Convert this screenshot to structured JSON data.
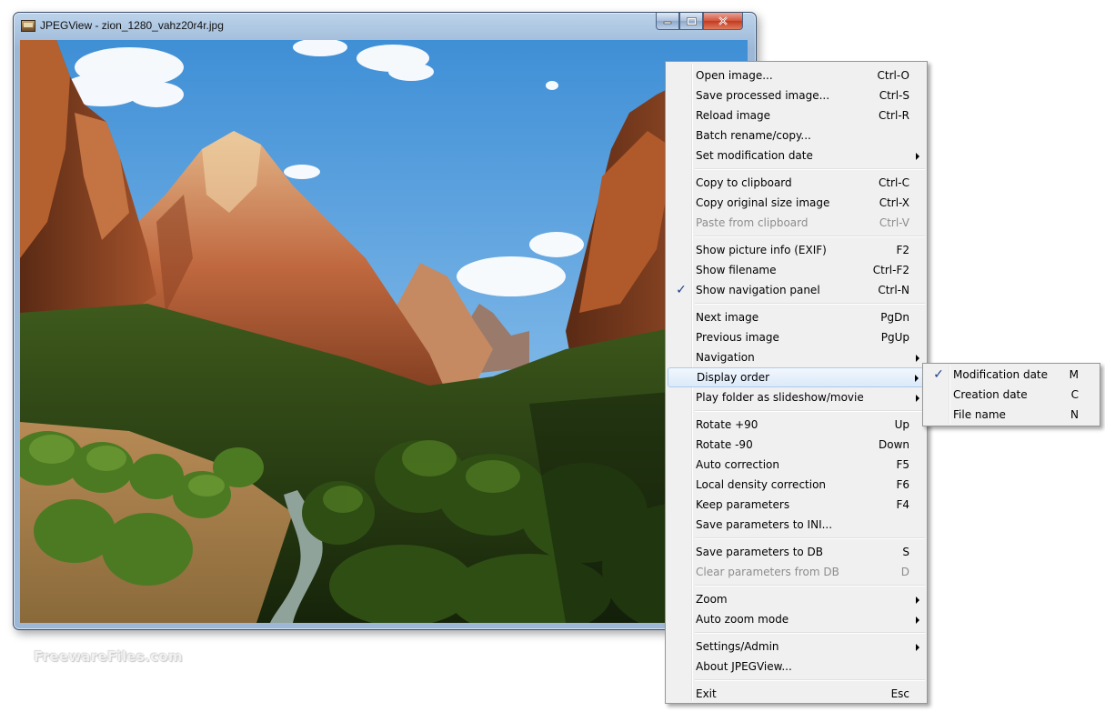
{
  "window": {
    "title": "JPEGView - zion_1280_vahz20r4r.jpg",
    "caption_buttons": {
      "minimize": "▭",
      "maximize": "▢",
      "close": "x"
    }
  },
  "watermark": "FreewareFiles.com",
  "context_menu": {
    "groups": [
      [
        {
          "label": "Open image...",
          "shortcut": "Ctrl-O"
        },
        {
          "label": "Save processed image...",
          "shortcut": "Ctrl-S"
        },
        {
          "label": "Reload image",
          "shortcut": "Ctrl-R"
        },
        {
          "label": "Batch rename/copy...",
          "shortcut": ""
        },
        {
          "label": "Set modification date",
          "shortcut": "",
          "submenu": true
        }
      ],
      [
        {
          "label": "Copy to clipboard",
          "shortcut": "Ctrl-C"
        },
        {
          "label": "Copy original size image",
          "shortcut": "Ctrl-X"
        },
        {
          "label": "Paste from clipboard",
          "shortcut": "Ctrl-V",
          "disabled": true
        }
      ],
      [
        {
          "label": "Show picture info (EXIF)",
          "shortcut": "F2"
        },
        {
          "label": "Show filename",
          "shortcut": "Ctrl-F2"
        },
        {
          "label": "Show navigation panel",
          "shortcut": "Ctrl-N",
          "checked": true
        }
      ],
      [
        {
          "label": "Next image",
          "shortcut": "PgDn"
        },
        {
          "label": "Previous image",
          "shortcut": "PgUp"
        },
        {
          "label": "Navigation",
          "shortcut": "",
          "submenu": true
        },
        {
          "label": "Display order",
          "shortcut": "",
          "submenu": true,
          "highlighted": true
        },
        {
          "label": "Play folder as slideshow/movie",
          "shortcut": "",
          "submenu": true
        }
      ],
      [
        {
          "label": "Rotate +90",
          "shortcut": "Up"
        },
        {
          "label": "Rotate -90",
          "shortcut": "Down"
        },
        {
          "label": "Auto correction",
          "shortcut": "F5"
        },
        {
          "label": "Local density correction",
          "shortcut": "F6"
        },
        {
          "label": "Keep parameters",
          "shortcut": "F4"
        },
        {
          "label": "Save parameters to INI...",
          "shortcut": ""
        }
      ],
      [
        {
          "label": "Save parameters to DB",
          "shortcut": "S"
        },
        {
          "label": "Clear parameters from DB",
          "shortcut": "D",
          "disabled": true
        }
      ],
      [
        {
          "label": "Zoom",
          "shortcut": "",
          "submenu": true
        },
        {
          "label": "Auto zoom mode",
          "shortcut": "",
          "submenu": true
        }
      ],
      [
        {
          "label": "Settings/Admin",
          "shortcut": "",
          "submenu": true
        },
        {
          "label": "About JPEGView...",
          "shortcut": ""
        }
      ],
      [
        {
          "label": "Exit",
          "shortcut": "Esc"
        }
      ]
    ]
  },
  "display_order_submenu": {
    "items": [
      {
        "label": "Modification date",
        "shortcut": "M",
        "checked": true
      },
      {
        "label": "Creation date",
        "shortcut": "C"
      },
      {
        "label": "File name",
        "shortcut": "N"
      }
    ]
  },
  "icons": {
    "check": "✓",
    "app": "jpegview-app-icon"
  }
}
